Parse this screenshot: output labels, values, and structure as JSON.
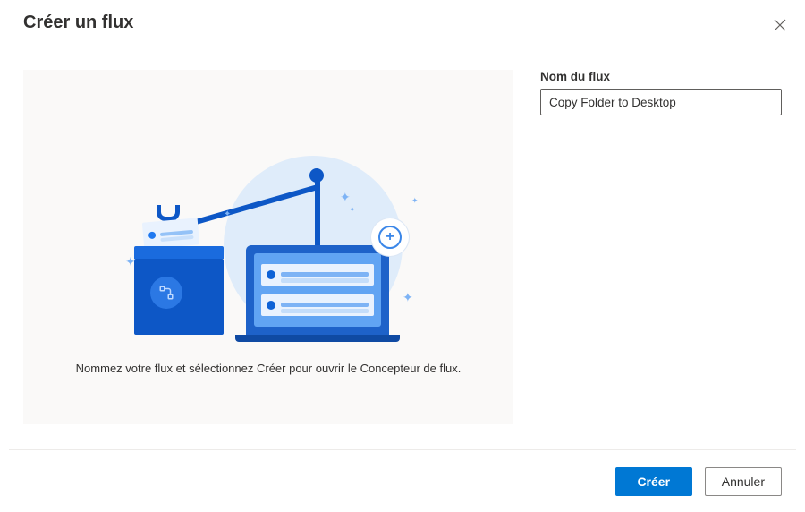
{
  "dialog": {
    "title": "Créer un flux",
    "preview_caption": "Nommez votre flux et sélectionnez Créer pour ouvrir le Concepteur de flux."
  },
  "form": {
    "flow_name_label": "Nom du flux",
    "flow_name_value": "Copy Folder to Desktop"
  },
  "footer": {
    "create_label": "Créer",
    "cancel_label": "Annuler"
  },
  "icons": {
    "close": "close-icon",
    "plus": "plus-icon",
    "flow_badge": "flow-icon"
  },
  "colors": {
    "primary": "#0078d4",
    "panel_bg": "#faf9f8",
    "illus_light": "#dfecfa",
    "illus_mid": "#61a4f3",
    "illus_dark": "#0d57c6"
  }
}
